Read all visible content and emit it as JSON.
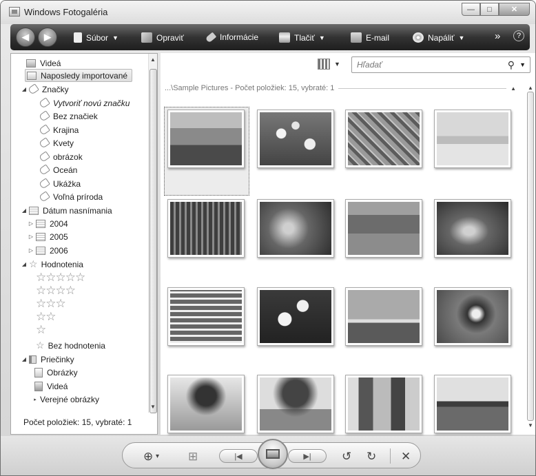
{
  "window": {
    "title": "Windows Fotogaléria"
  },
  "window_controls": {
    "minimize": "—",
    "maximize": "□",
    "close": "✕"
  },
  "toolbar": {
    "back": "◀",
    "forward": "▶",
    "file": "Súbor",
    "fix": "Opraviť",
    "info": "Informácie",
    "print": "Tlačiť",
    "email": "E-mail",
    "burn": "Napáliť",
    "more": "»",
    "help": "?"
  },
  "tree": {
    "videos_top": "Videá",
    "recently_imported": "Naposledy importované",
    "tags_header": "Značky",
    "tags": [
      "Vytvoriť novú značku",
      "Bez značiek",
      "Krajina",
      "Kvety",
      "obrázok",
      "Oceán",
      "Ukážka",
      "Voľná príroda"
    ],
    "date_header": "Dátum nasnímania",
    "years": [
      "2004",
      "2005",
      "2006"
    ],
    "ratings_header": "Hodnotenia",
    "rating_rows": [
      "☆☆☆☆☆",
      "☆☆☆☆",
      "☆☆☆",
      "☆☆",
      "☆"
    ],
    "no_rating": "Bez hodnotenia",
    "folders_header": "Priečinky",
    "folders": [
      "Obrázky",
      "Videá",
      "Verejné obrázky"
    ]
  },
  "left_status": "Počet položiek: 15, vybraté: 1",
  "search": {
    "placeholder": "Hľadať"
  },
  "path_header": "...\\Sample Pictures - Počet položiek: 15, vybraté: 1",
  "thumbnails": [
    {
      "name": "photo-desert-buttes",
      "selected": true
    },
    {
      "name": "photo-white-flowers"
    },
    {
      "name": "photo-leaves"
    },
    {
      "name": "photo-sand-dunes-oryx"
    },
    {
      "name": "photo-forest-path"
    },
    {
      "name": "photo-plants-closeup"
    },
    {
      "name": "photo-green-valley"
    },
    {
      "name": "photo-sea-turtle"
    },
    {
      "name": "photo-waterfall"
    },
    {
      "name": "photo-frangipani"
    },
    {
      "name": "photo-ocean-pier"
    },
    {
      "name": "photo-toucan"
    },
    {
      "name": "photo-tree-fog"
    },
    {
      "name": "photo-autumn-tree"
    },
    {
      "name": "photo-people"
    },
    {
      "name": "photo-whale-tail"
    }
  ],
  "bottom": {
    "zoom": "⊕",
    "zoom_dd": "▾",
    "grid": "⊞",
    "prev": "|◀",
    "next": "▶|",
    "rotate_ccw": "↺",
    "rotate_cw": "↻",
    "delete": "✕"
  }
}
